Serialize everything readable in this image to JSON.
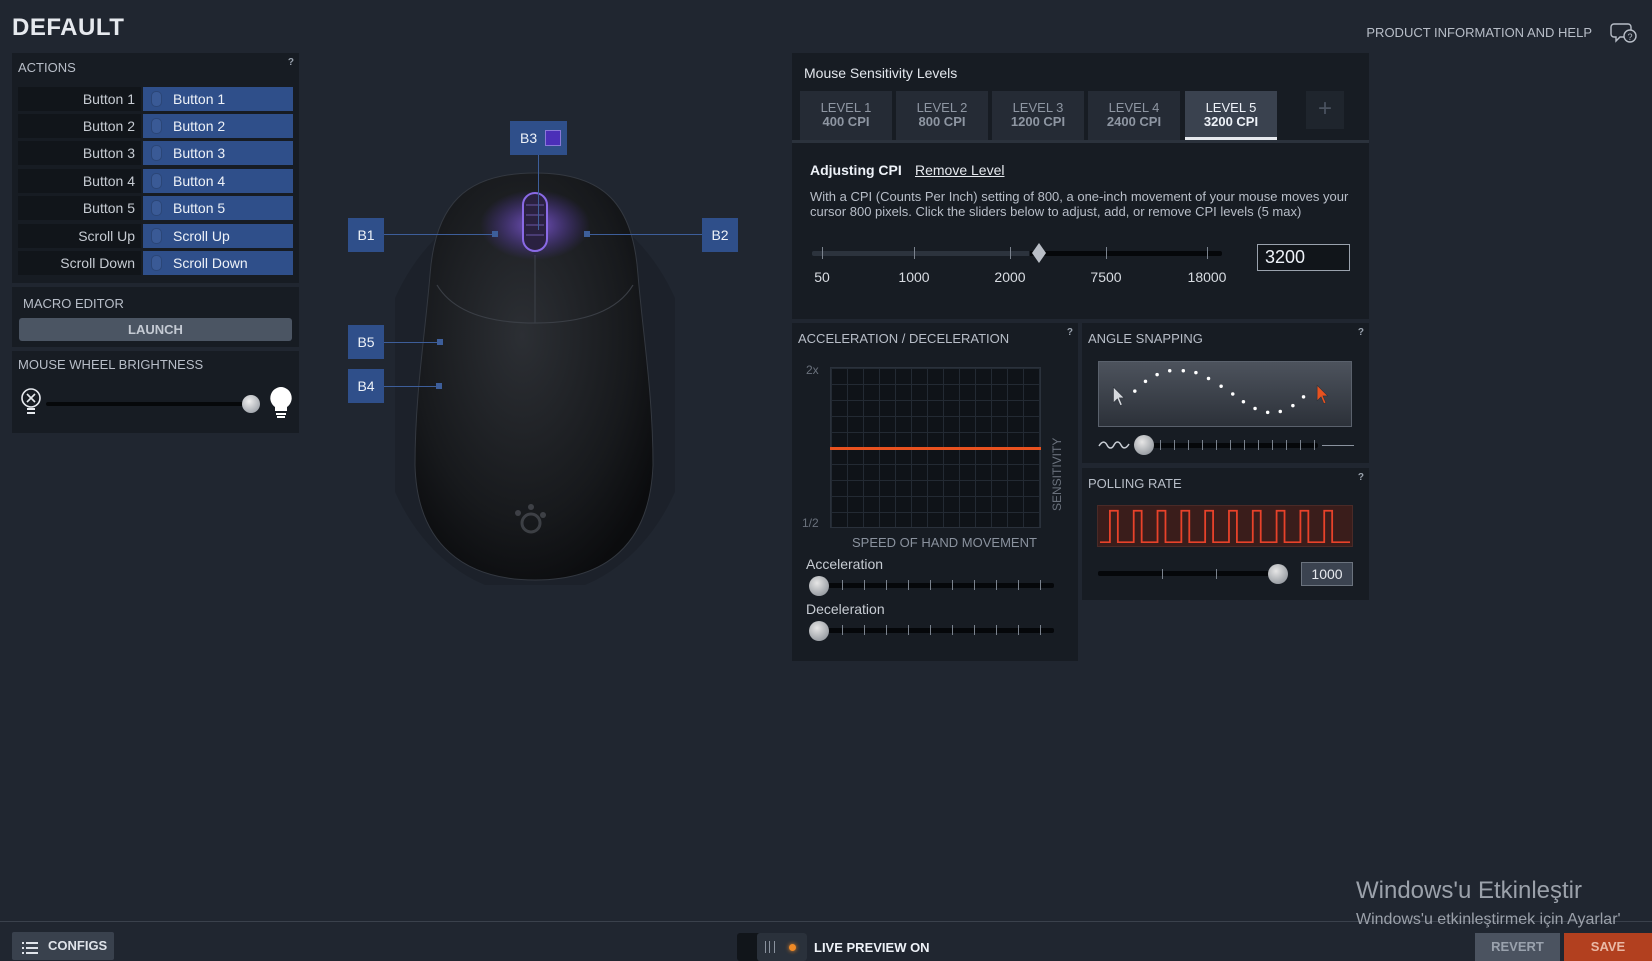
{
  "header": {
    "title": "DEFAULT",
    "help_link": "PRODUCT INFORMATION AND HELP",
    "help_icon": "chat-help-icon"
  },
  "actions": {
    "title": "ACTIONS",
    "help": "?",
    "rows": [
      {
        "name": "Button 1",
        "value": "Button 1"
      },
      {
        "name": "Button 2",
        "value": "Button 2"
      },
      {
        "name": "Button 3",
        "value": "Button 3"
      },
      {
        "name": "Button 4",
        "value": "Button 4"
      },
      {
        "name": "Button 5",
        "value": "Button 5"
      },
      {
        "name": "Scroll Up",
        "value": "Scroll Up"
      },
      {
        "name": "Scroll Down",
        "value": "Scroll Down"
      }
    ]
  },
  "macro": {
    "title": "MACRO EDITOR",
    "launch_label": "LAUNCH"
  },
  "brightness": {
    "title": "MOUSE WHEEL BRIGHTNESS",
    "level": 1.0
  },
  "mouse_labels": {
    "b1": "B1",
    "b2": "B2",
    "b3": "B3",
    "b4": "B4",
    "b5": "B5"
  },
  "sensitivity": {
    "title": "Mouse Sensitivity Levels",
    "levels": [
      {
        "label": "LEVEL 1",
        "cpi": "400 CPI"
      },
      {
        "label": "LEVEL 2",
        "cpi": "800 CPI"
      },
      {
        "label": "LEVEL 3",
        "cpi": "1200 CPI"
      },
      {
        "label": "LEVEL 4",
        "cpi": "2400 CPI"
      },
      {
        "label": "LEVEL 5",
        "cpi": "3200 CPI"
      }
    ],
    "active_level": 5,
    "add_label": "+",
    "adjusting_label": "Adjusting CPI",
    "remove_label": "Remove Level",
    "description": "With a CPI (Counts Per Inch) setting of 800, a one-inch movement of your mouse moves your cursor 800 pixels. Click the sliders below to adjust, add, or remove CPI levels (5 max)",
    "scale_labels": [
      "50",
      "1000",
      "2000",
      "7500",
      "18000"
    ],
    "value": "3200"
  },
  "acceleration": {
    "title": "ACCELERATION / DECELERATION",
    "help": "?",
    "y_top": "2x",
    "y_bottom": "1/2",
    "y_axis": "SENSITIVITY",
    "x_axis": "SPEED OF HAND MOVEMENT",
    "accel_label": "Acceleration",
    "decel_label": "Deceleration",
    "accel_value": 0,
    "decel_value": 0,
    "curve_color": "#e8521f"
  },
  "angle_snapping": {
    "title": "ANGLE SNAPPING",
    "help": "?",
    "level": 0
  },
  "polling": {
    "title": "POLLING RATE",
    "help": "?",
    "value": "1000"
  },
  "bottom": {
    "configs_label": "CONFIGS",
    "live_preview_label": "LIVE PREVIEW ON",
    "revert_label": "REVERT",
    "save_label": "SAVE",
    "accent_color": "#b2401f"
  },
  "watermark": {
    "title": "Windows'u Etkinleştir",
    "subtitle": "Windows'u etkinleştirmek için Ayarlar'"
  }
}
